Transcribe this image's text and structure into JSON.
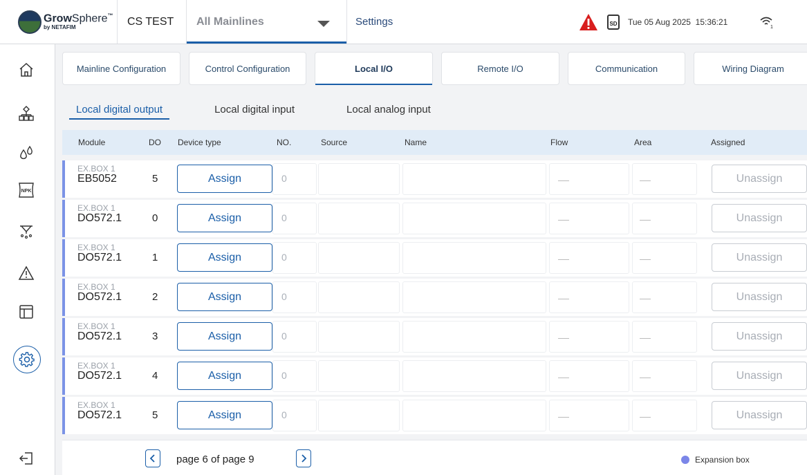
{
  "header": {
    "brand_main": "Grow",
    "brand_rest": "Sphere",
    "brand_tm": "™",
    "brand_sub": "by NETAFIM",
    "site": "CS TEST",
    "mainline": "All Mainlines",
    "section": "Settings",
    "sd_label": "SD",
    "date": "Tue 05 Aug 2025",
    "time": "15:36:21",
    "wifi_sub": "1"
  },
  "sidebar": {
    "items": [
      "home-icon",
      "network-icon",
      "water-drops-icon",
      "npk-icon",
      "irrigation-icon",
      "alarm-icon",
      "table-icon",
      "settings-icon",
      "logout-icon"
    ],
    "npk_label": "NPK"
  },
  "tabs": [
    {
      "label": "Mainline Configuration"
    },
    {
      "label": "Control Configuration"
    },
    {
      "label": "Local I/O"
    },
    {
      "label": "Remote  I/O"
    },
    {
      "label": "Communication"
    },
    {
      "label": "Wiring Diagram"
    }
  ],
  "subtabs": [
    {
      "label": "Local digital output"
    },
    {
      "label": "Local digital input"
    },
    {
      "label": "Local analog input"
    }
  ],
  "table": {
    "headers": {
      "module": "Module",
      "do": "DO",
      "device_type": "Device type",
      "no": "NO.",
      "source": "Source",
      "name": "Name",
      "flow": "Flow",
      "area": "Area",
      "assigned": "Assigned"
    },
    "rows": [
      {
        "box": "EX.BOX 1",
        "module": "EB5052",
        "do": "5",
        "assign": "Assign",
        "no": "0",
        "unassign": "Unassign"
      },
      {
        "box": "EX.BOX 1",
        "module": "DO572.1",
        "do": "0",
        "assign": "Assign",
        "no": "0",
        "unassign": "Unassign"
      },
      {
        "box": "EX.BOX 1",
        "module": "DO572.1",
        "do": "1",
        "assign": "Assign",
        "no": "0",
        "unassign": "Unassign"
      },
      {
        "box": "EX.BOX 1",
        "module": "DO572.1",
        "do": "2",
        "assign": "Assign",
        "no": "0",
        "unassign": "Unassign"
      },
      {
        "box": "EX.BOX 1",
        "module": "DO572.1",
        "do": "3",
        "assign": "Assign",
        "no": "0",
        "unassign": "Unassign"
      },
      {
        "box": "EX.BOX 1",
        "module": "DO572.1",
        "do": "4",
        "assign": "Assign",
        "no": "0",
        "unassign": "Unassign"
      },
      {
        "box": "EX.BOX 1",
        "module": "DO572.1",
        "do": "5",
        "assign": "Assign",
        "no": "0",
        "unassign": "Unassign"
      }
    ]
  },
  "pagination": {
    "text": "page 6 of page  9",
    "current_page": 6,
    "total_pages": 9
  },
  "legend": {
    "label": "Expansion box",
    "color": "#7b86e8"
  },
  "colors": {
    "accent": "#1a5ea8",
    "alert": "#d81e1e",
    "row_marker": "#7b93e6",
    "header_bg": "#e1ecf7"
  }
}
